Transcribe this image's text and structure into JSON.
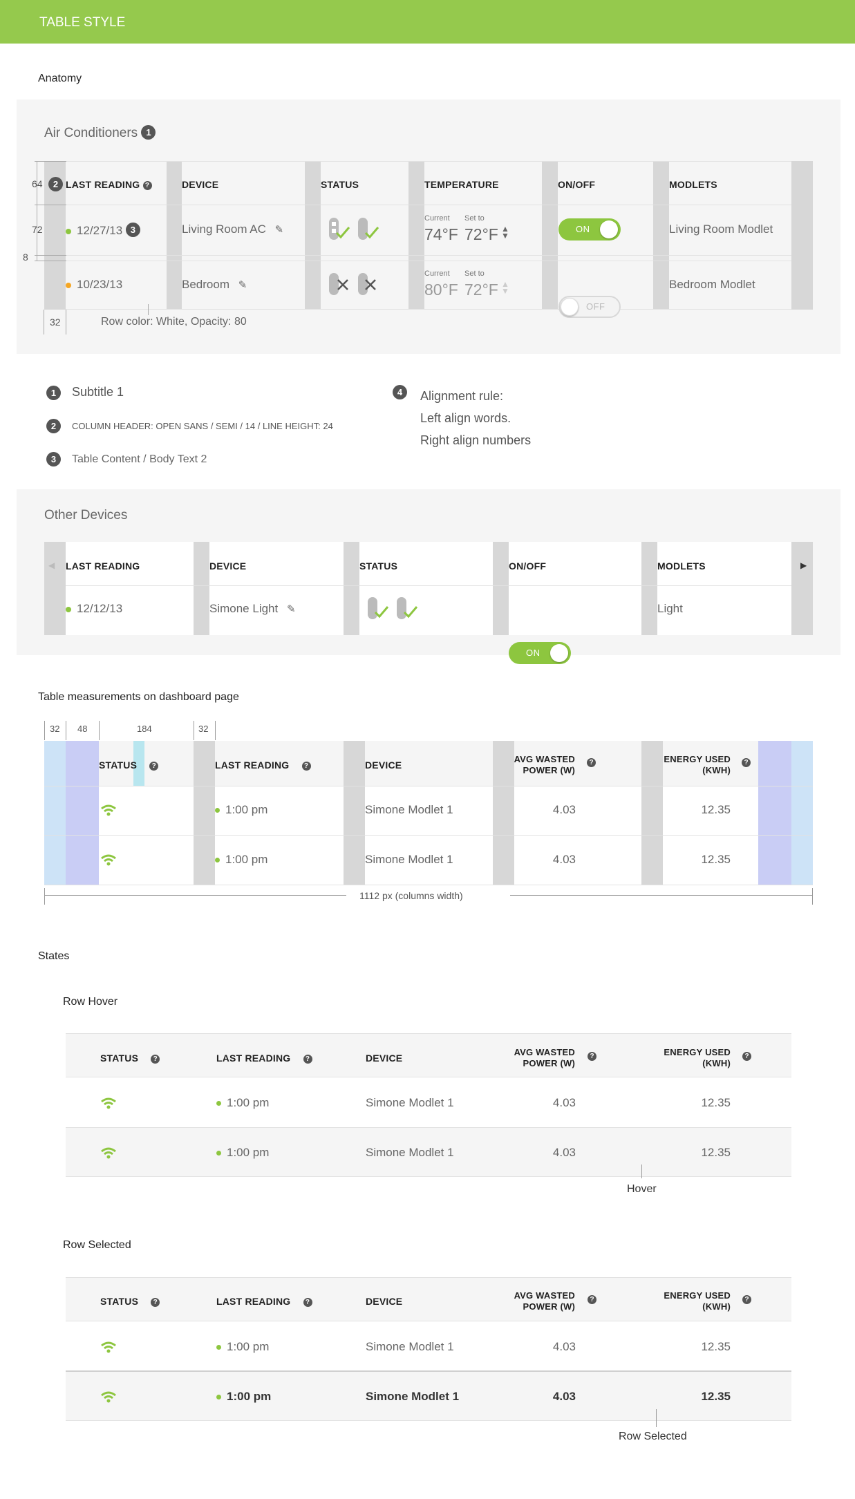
{
  "header": {
    "title": "TABLE STYLE"
  },
  "anatomy": {
    "title": "Anatomy",
    "card_title": "Air Conditioners",
    "num1": "1",
    "num2": "2",
    "num3": "3",
    "num4": "4",
    "cols": [
      "LAST READING",
      "DEVICE",
      "STATUS",
      "TEMPERATURE",
      "ON/OFF",
      "MODLETS"
    ],
    "rows": [
      {
        "date": "12/27/13",
        "device": "Living Room AC",
        "cur_label": "Current",
        "set_label": "Set to",
        "cur": "74°F",
        "set": "72°F",
        "toggle": "ON",
        "modlet": "Living Room Modlet"
      },
      {
        "date": "10/23/13",
        "device": "Bedroom",
        "cur_label": "Current",
        "set_label": "Set to",
        "cur": "80°F",
        "set": "72°F",
        "toggle": "OFF",
        "modlet": "Bedroom Modlet"
      }
    ],
    "m64": "64",
    "m72": "72",
    "m8": "8",
    "m32": "32",
    "row_color": "Row color: White, Opacity: 80"
  },
  "legend": {
    "l1": "Subtitle 1",
    "l2": "COLUMN HEADER: OPEN SANS / SEMI / 14 / LINE HEIGHT: 24",
    "l3": "Table Content / Body Text 2",
    "l4a": "Alignment rule:",
    "l4b": "Left align words.",
    "l4c": "Right align numbers"
  },
  "other": {
    "title": "Other Devices",
    "cols": [
      "LAST READING",
      "DEVICE",
      "STATUS",
      "ON/OFF",
      "MODLETS"
    ],
    "row": {
      "date": "12/12/13",
      "device": "Simone Light",
      "toggle": "ON",
      "modlet": "Light"
    }
  },
  "measure": {
    "title": "Table measurements on dashboard page",
    "m32a": "32",
    "m48": "48",
    "m184": "184",
    "m32b": "32",
    "cols": [
      "STATUS",
      "LAST READING",
      "DEVICE",
      "AVG WASTED\nPOWER (W)",
      "ENERGY USED\n(KWH)"
    ],
    "avg1": "AVG WASTED",
    "avg2": "POWER (W)",
    "en1": "ENERGY USED",
    "en2": "(KWH)",
    "rows": [
      {
        "time": "1:00 pm",
        "device": "Simone Modlet 1",
        "avg": "4.03",
        "energy": "12.35"
      },
      {
        "time": "1:00 pm",
        "device": "Simone Modlet 1",
        "avg": "4.03",
        "energy": "12.35"
      }
    ],
    "width_label": "1112 px (columns width)"
  },
  "states": {
    "title": "States",
    "hover_title": "Row Hover",
    "hover_label": "Hover",
    "selected_title": "Row Selected",
    "selected_label": "Row Selected",
    "cols": [
      "STATUS",
      "LAST READING",
      "DEVICE"
    ],
    "avg1": "AVG WASTED",
    "avg2": "POWER (W)",
    "en1": "ENERGY USED",
    "en2": "(KWH)",
    "rows": [
      {
        "time": "1:00 pm",
        "device": "Simone Modlet 1",
        "avg": "4.03",
        "energy": "12.35"
      },
      {
        "time": "1:00 pm",
        "device": "Simone Modlet 1",
        "avg": "4.03",
        "energy": "12.35"
      }
    ]
  },
  "colors": {
    "accent": "#8dc63f",
    "warning": "#f5a623",
    "gray": "#d7d7d7",
    "blue": "#cde3f7",
    "purple": "#c9cdf5",
    "cyan": "#b8e6ef"
  }
}
